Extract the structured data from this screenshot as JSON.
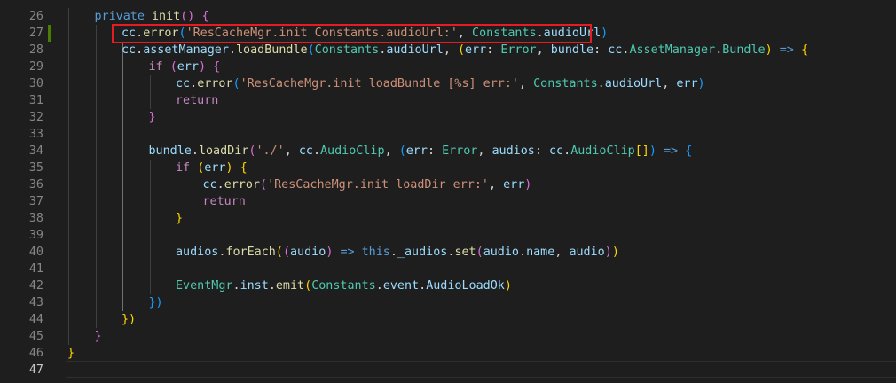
{
  "editor": {
    "highlight_color": "#e51c23",
    "lines": [
      {
        "num": "26",
        "indent": 1,
        "tokens": [
          [
            "kw",
            "private "
          ],
          [
            "fn",
            "init"
          ],
          [
            "b2",
            "()"
          ],
          [
            "p",
            " "
          ],
          [
            "b2",
            "{"
          ]
        ]
      },
      {
        "num": "27",
        "indent": 2,
        "tokens": [
          [
            "var",
            "cc"
          ],
          [
            "p",
            "."
          ],
          [
            "fn",
            "error"
          ],
          [
            "b3",
            "("
          ],
          [
            "str",
            "'ResCacheMgr.init Constants.audioUrl:'"
          ],
          [
            "p",
            ", "
          ],
          [
            "cls",
            "Constants"
          ],
          [
            "p",
            "."
          ],
          [
            "var",
            "audioUrl"
          ],
          [
            "b3",
            ")"
          ]
        ]
      },
      {
        "num": "28",
        "indent": 2,
        "tokens": [
          [
            "var",
            "cc"
          ],
          [
            "p",
            "."
          ],
          [
            "var",
            "assetManager"
          ],
          [
            "p",
            "."
          ],
          [
            "fn",
            "loadBundle"
          ],
          [
            "b3",
            "("
          ],
          [
            "cls",
            "Constants"
          ],
          [
            "p",
            "."
          ],
          [
            "var",
            "audioUrl"
          ],
          [
            "p",
            ", "
          ],
          [
            "b1",
            "("
          ],
          [
            "var",
            "err"
          ],
          [
            "p",
            ": "
          ],
          [
            "cls",
            "Error"
          ],
          [
            "p",
            ", "
          ],
          [
            "var",
            "bundle"
          ],
          [
            "p",
            ": "
          ],
          [
            "var",
            "cc"
          ],
          [
            "p",
            "."
          ],
          [
            "cls",
            "AssetManager"
          ],
          [
            "p",
            "."
          ],
          [
            "cls",
            "Bundle"
          ],
          [
            "b1",
            ")"
          ],
          [
            "p",
            " "
          ],
          [
            "ar",
            "=>"
          ],
          [
            "p",
            " "
          ],
          [
            "b1",
            "{"
          ]
        ]
      },
      {
        "num": "29",
        "indent": 3,
        "tokens": [
          [
            "ctl",
            "if "
          ],
          [
            "b2",
            "("
          ],
          [
            "var",
            "err"
          ],
          [
            "b2",
            ")"
          ],
          [
            "p",
            " "
          ],
          [
            "b2",
            "{"
          ]
        ]
      },
      {
        "num": "30",
        "indent": 4,
        "tokens": [
          [
            "var",
            "cc"
          ],
          [
            "p",
            "."
          ],
          [
            "fn",
            "error"
          ],
          [
            "b3",
            "("
          ],
          [
            "str",
            "'ResCacheMgr.init loadBundle [%s] err:'"
          ],
          [
            "p",
            ", "
          ],
          [
            "cls",
            "Constants"
          ],
          [
            "p",
            "."
          ],
          [
            "var",
            "audioUrl"
          ],
          [
            "p",
            ", "
          ],
          [
            "var",
            "err"
          ],
          [
            "b3",
            ")"
          ]
        ]
      },
      {
        "num": "31",
        "indent": 4,
        "tokens": [
          [
            "ctl",
            "return"
          ]
        ]
      },
      {
        "num": "32",
        "indent": 3,
        "tokens": [
          [
            "b2",
            "}"
          ]
        ]
      },
      {
        "num": "33",
        "indent": 0,
        "tokens": []
      },
      {
        "num": "34",
        "indent": 3,
        "tokens": [
          [
            "var",
            "bundle"
          ],
          [
            "p",
            "."
          ],
          [
            "fn",
            "loadDir"
          ],
          [
            "b2",
            "("
          ],
          [
            "str",
            "'./'"
          ],
          [
            "p",
            ", "
          ],
          [
            "var",
            "cc"
          ],
          [
            "p",
            "."
          ],
          [
            "cls",
            "AudioClip"
          ],
          [
            "p",
            ", "
          ],
          [
            "b3",
            "("
          ],
          [
            "var",
            "err"
          ],
          [
            "p",
            ": "
          ],
          [
            "cls",
            "Error"
          ],
          [
            "p",
            ", "
          ],
          [
            "var",
            "audios"
          ],
          [
            "p",
            ": "
          ],
          [
            "var",
            "cc"
          ],
          [
            "p",
            "."
          ],
          [
            "cls",
            "AudioClip"
          ],
          [
            "b1",
            "[]"
          ],
          [
            "b3",
            ")"
          ],
          [
            "p",
            " "
          ],
          [
            "ar",
            "=>"
          ],
          [
            "p",
            " "
          ],
          [
            "b3",
            "{"
          ]
        ]
      },
      {
        "num": "35",
        "indent": 4,
        "tokens": [
          [
            "ctl",
            "if "
          ],
          [
            "b1",
            "("
          ],
          [
            "var",
            "err"
          ],
          [
            "b1",
            ")"
          ],
          [
            "p",
            " "
          ],
          [
            "b1",
            "{"
          ]
        ]
      },
      {
        "num": "36",
        "indent": 5,
        "tokens": [
          [
            "var",
            "cc"
          ],
          [
            "p",
            "."
          ],
          [
            "fn",
            "error"
          ],
          [
            "b2",
            "("
          ],
          [
            "str",
            "'ResCacheMgr.init loadDir err:'"
          ],
          [
            "p",
            ", "
          ],
          [
            "var",
            "err"
          ],
          [
            "b2",
            ")"
          ]
        ]
      },
      {
        "num": "37",
        "indent": 5,
        "tokens": [
          [
            "ctl",
            "return"
          ]
        ]
      },
      {
        "num": "38",
        "indent": 4,
        "tokens": [
          [
            "b1",
            "}"
          ]
        ]
      },
      {
        "num": "39",
        "indent": 0,
        "tokens": []
      },
      {
        "num": "40",
        "indent": 4,
        "tokens": [
          [
            "var",
            "audios"
          ],
          [
            "p",
            "."
          ],
          [
            "fn",
            "forEach"
          ],
          [
            "b1",
            "("
          ],
          [
            "b2",
            "("
          ],
          [
            "var",
            "audio"
          ],
          [
            "b2",
            ")"
          ],
          [
            "p",
            " "
          ],
          [
            "ar",
            "=>"
          ],
          [
            "p",
            " "
          ],
          [
            "kw",
            "this"
          ],
          [
            "p",
            "."
          ],
          [
            "var",
            "_audios"
          ],
          [
            "p",
            "."
          ],
          [
            "fn",
            "set"
          ],
          [
            "b2",
            "("
          ],
          [
            "var",
            "audio"
          ],
          [
            "p",
            "."
          ],
          [
            "var",
            "name"
          ],
          [
            "p",
            ", "
          ],
          [
            "var",
            "audio"
          ],
          [
            "b2",
            ")"
          ],
          [
            "b1",
            ")"
          ]
        ]
      },
      {
        "num": "41",
        "indent": 0,
        "tokens": []
      },
      {
        "num": "42",
        "indent": 4,
        "tokens": [
          [
            "cls",
            "EventMgr"
          ],
          [
            "p",
            "."
          ],
          [
            "var",
            "inst"
          ],
          [
            "p",
            "."
          ],
          [
            "fn",
            "emit"
          ],
          [
            "b1",
            "("
          ],
          [
            "cls",
            "Constants"
          ],
          [
            "p",
            "."
          ],
          [
            "var",
            "event"
          ],
          [
            "p",
            "."
          ],
          [
            "var",
            "AudioLoadOk"
          ],
          [
            "b1",
            ")"
          ]
        ]
      },
      {
        "num": "43",
        "indent": 3,
        "tokens": [
          [
            "b3",
            "})"
          ]
        ]
      },
      {
        "num": "44",
        "indent": 2,
        "tokens": [
          [
            "b1",
            "})"
          ]
        ]
      },
      {
        "num": "45",
        "indent": 1,
        "tokens": [
          [
            "b2",
            "}"
          ]
        ]
      },
      {
        "num": "46",
        "indent": 0,
        "tokens": [
          [
            "b1",
            "}"
          ]
        ]
      },
      {
        "num": "47",
        "indent": 0,
        "tokens": []
      }
    ]
  }
}
